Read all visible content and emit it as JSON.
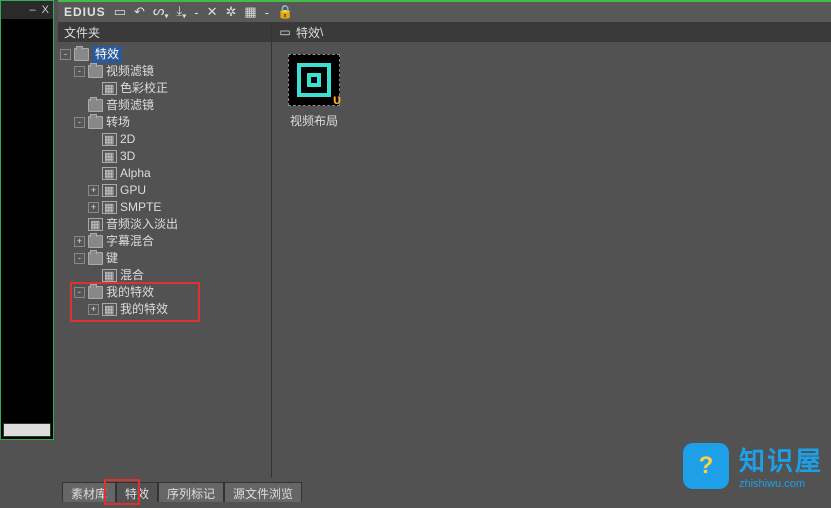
{
  "app": {
    "title": "EDIUS"
  },
  "left_window": {
    "minimize": "–",
    "close": "X"
  },
  "toolbar_icons": [
    "folder",
    "undo",
    "link",
    "down",
    "dash",
    "close",
    "gear",
    "grid",
    "dash2",
    "lock"
  ],
  "tree_panel": {
    "title": "文件夹"
  },
  "view_panel": {
    "title": "特效",
    "path": "\\"
  },
  "tree": {
    "root": "特效",
    "video_filter": "视频滤镜",
    "color_correction": "色彩校正",
    "audio_filter": "音频滤镜",
    "transition": "转场",
    "t_2d": "2D",
    "t_3d": "3D",
    "t_alpha": "Alpha",
    "t_gpu": "GPU",
    "t_smpte": "SMPTE",
    "audio_fade": "音频淡入淡出",
    "subtitle_mix": "字幕混合",
    "keys": "键",
    "blend": "混合",
    "my_effects": "我的特效",
    "my_effects_child": "我的特效"
  },
  "thumb": {
    "label": "视频布局"
  },
  "tabs": {
    "library": "素材库",
    "effects": "特效",
    "markers": "序列标记",
    "browser": "源文件浏览"
  },
  "watermark": {
    "title": "知识屋",
    "sub": "zhishiwu.com"
  }
}
